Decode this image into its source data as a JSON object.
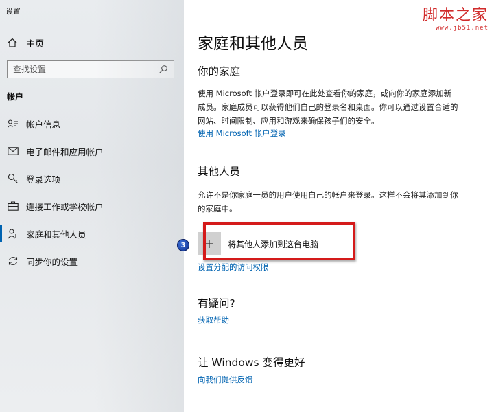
{
  "window": {
    "title": "设置"
  },
  "sidebar": {
    "home_label": "主页",
    "search_placeholder": "查找设置",
    "section_label": "帐户",
    "items": [
      {
        "label": "帐户信息",
        "icon": "person-card-icon"
      },
      {
        "label": "电子邮件和应用帐户",
        "icon": "mail-icon"
      },
      {
        "label": "登录选项",
        "icon": "key-icon"
      },
      {
        "label": "连接工作或学校帐户",
        "icon": "briefcase-icon"
      },
      {
        "label": "家庭和其他人员",
        "icon": "people-icon",
        "active": true
      },
      {
        "label": "同步你的设置",
        "icon": "sync-icon"
      }
    ]
  },
  "main": {
    "title": "家庭和其他人员",
    "family": {
      "heading": "你的家庭",
      "description": "使用 Microsoft 帐户登录即可在此处查看你的家庭，或向你的家庭添加新成员。家庭成员可以获得他们自己的登录名和桌面。你可以通过设置合适的网站、时间限制、应用和游戏来确保孩子们的安全。",
      "link": "使用 Microsoft 帐户登录"
    },
    "others": {
      "heading": "其他人员",
      "description": "允许不是你家庭一员的用户使用自己的帐户来登录。这样不会将其添加到你的家庭中。",
      "add_label": "将其他人添加到这台电脑",
      "link": "设置分配的访问权限"
    },
    "help": {
      "heading": "有疑问?",
      "link": "获取帮助"
    },
    "feedback": {
      "heading": "让 Windows 变得更好",
      "link": "向我们提供反馈"
    }
  },
  "annotation": {
    "step": "3"
  },
  "watermark": {
    "name": "脚本之家",
    "url": "www.jb51.net"
  },
  "colors": {
    "accent": "#0063b1",
    "highlight": "#d41a1a",
    "watermark": "#d12b2b"
  }
}
